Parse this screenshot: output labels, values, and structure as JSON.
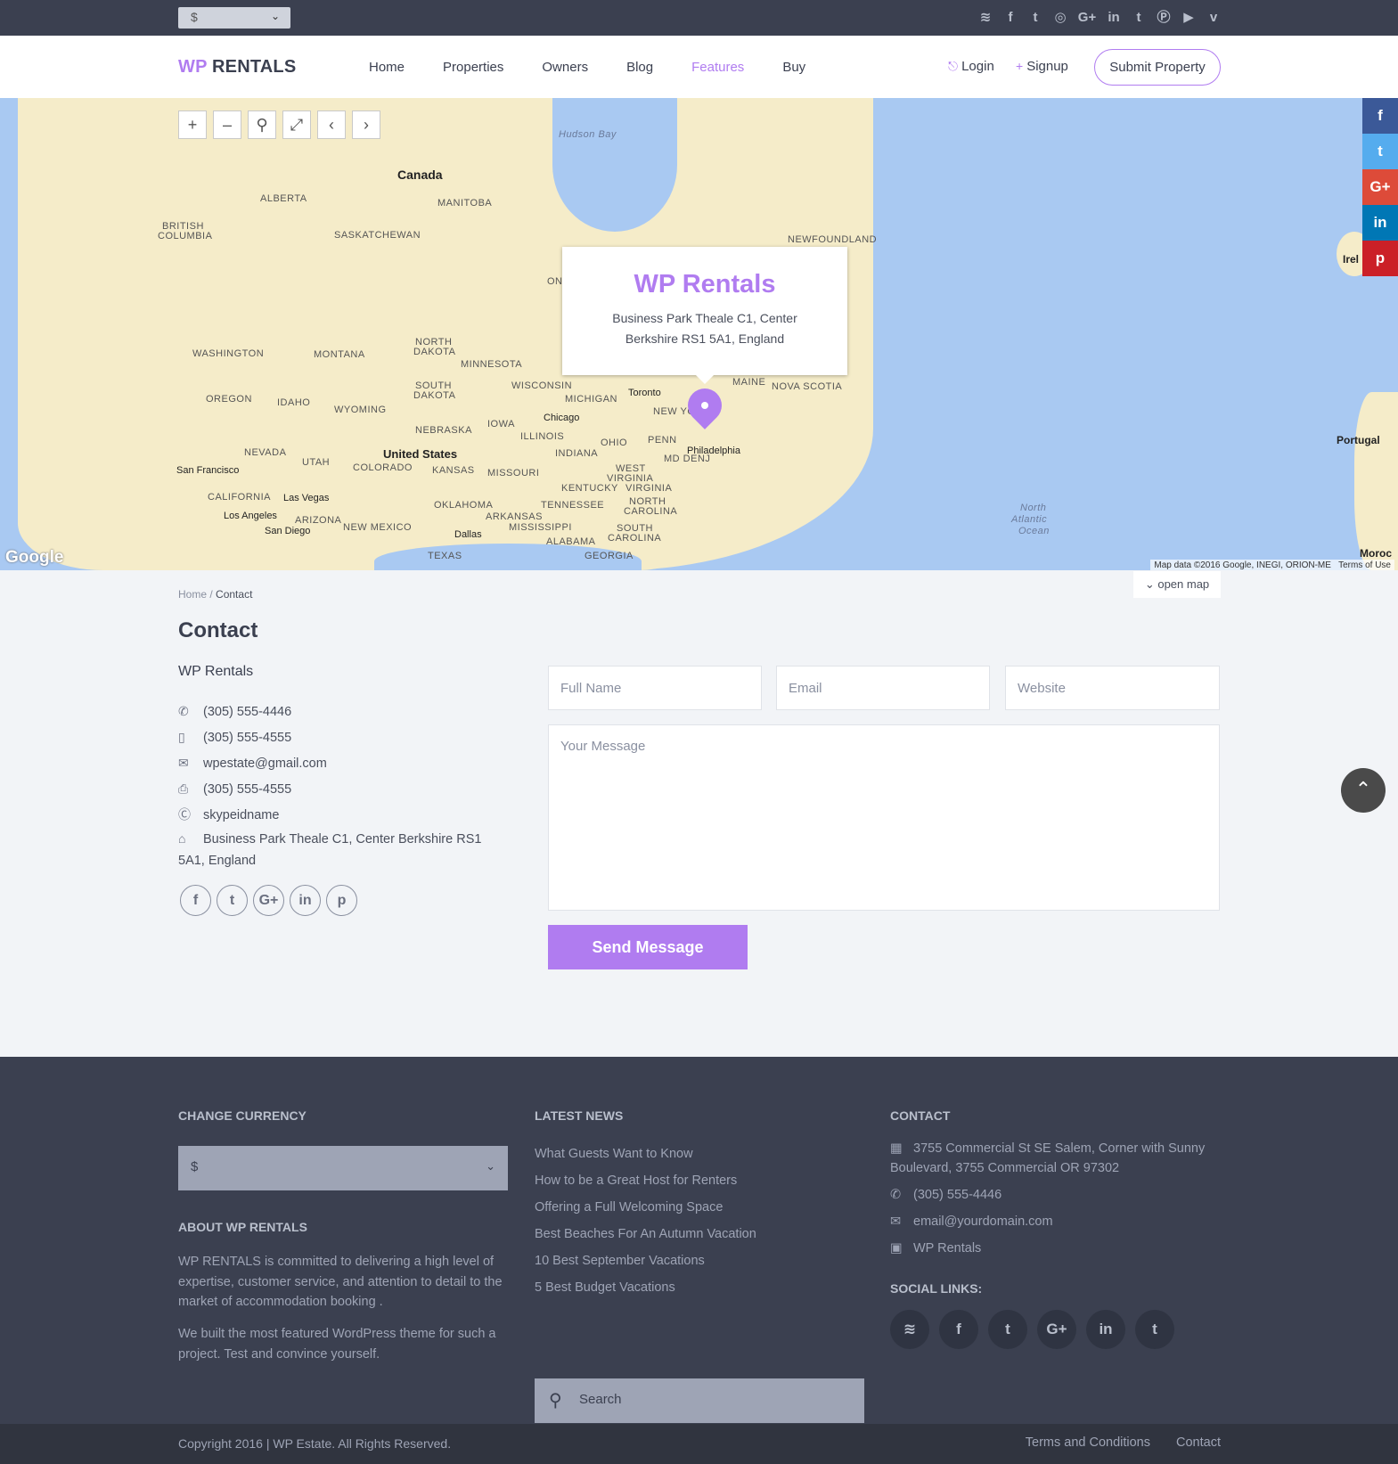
{
  "topbar": {
    "currency": "$",
    "social_icons": [
      "rss-icon",
      "facebook-icon",
      "twitter-icon",
      "dribbble-icon",
      "google-plus-icon",
      "linkedin-icon",
      "tumblr-icon",
      "pinterest-icon",
      "youtube-icon",
      "vimeo-icon"
    ]
  },
  "header": {
    "logo_wp": "WP",
    "logo_rest": "RENTALS",
    "nav": [
      "Home",
      "Properties",
      "Owners",
      "Blog",
      "Features",
      "Buy"
    ],
    "nav_active": "Features",
    "login": "Login",
    "signup": "Signup",
    "submit": "Submit Property"
  },
  "map": {
    "labels": {
      "hudson_bay": "Hudson Bay",
      "canada": "Canada",
      "alberta": "ALBERTA",
      "manitoba": "MANITOBA",
      "bc1": "BRITISH",
      "bc2": "COLUMBIA",
      "saskatchewan": "SASKATCHEWAN",
      "newfoundland": "NEWFOUNDLAND",
      "on": "ON",
      "washington": "WASHINGTON",
      "montana": "MONTANA",
      "north_dakota1": "NORTH",
      "north_dakota2": "DAKOTA",
      "minnesota": "MINNESOTA",
      "south_dakota1": "SOUTH",
      "south_dakota2": "DAKOTA",
      "wisconsin": "WISCONSIN",
      "michigan": "MICHIGAN",
      "toronto": "Toronto",
      "maine": "MAINE",
      "nova_scotia": "NOVA SCOTIA",
      "oregon": "OREGON",
      "idaho": "IDAHO",
      "wyoming": "WYOMING",
      "chicago": "Chicago",
      "iowa": "IOWA",
      "nebraska": "NEBRASKA",
      "new_york": "NEW YO",
      "nevada": "NEVADA",
      "united_states": "United States",
      "illinois": "ILLINOIS",
      "indiana": "INDIANA",
      "ohio": "OHIO",
      "penn": "PENN",
      "philadelphia": "Philadelphia",
      "utah": "UTAH",
      "colorado": "COLORADO",
      "kansas": "KANSAS",
      "missouri": "MISSOURI",
      "west_virginia1": "WEST",
      "west_virginia2": "VIRGINIA",
      "virginia": "VIRGINIA",
      "kentucky": "KENTUCKY",
      "md_denj": "MD DENJ",
      "san_francisco": "San Francisco",
      "california": "CALIFORNIA",
      "las_vegas": "Las Vegas",
      "los_angeles": "Los Angeles",
      "arizona": "ARIZONA",
      "san_diego": "San Diego",
      "new_mexico": "NEW MEXICO",
      "oklahoma": "OKLAHOMA",
      "arkansas": "ARKANSAS",
      "tennessee": "TENNESSEE",
      "north_carolina1": "NORTH",
      "north_carolina2": "CAROLINA",
      "dallas": "Dallas",
      "mississippi": "MISSISSIPPI",
      "south_carolina1": "SOUTH",
      "south_carolina2": "CAROLINA",
      "alabama": "ALABAMA",
      "georgia": "GEORGIA",
      "texas": "TEXAS",
      "ireland": "Irel",
      "portugal": "Portugal",
      "morocco": "Moroc",
      "ocean1": "North",
      "ocean2": "Atlantic",
      "ocean3": "Ocean"
    },
    "info_title": "WP Rentals",
    "info_address": "Business Park Theale C1, Center Berkshire RS1 5A1, England",
    "google": "Google",
    "map_data": "Map data ©2016 Google, INEGI, ORION-ME",
    "terms": "Terms of Use"
  },
  "side_share": [
    "f",
    "t",
    "G+",
    "in",
    "p"
  ],
  "contact": {
    "open_map": "open map",
    "breadcrumb_home": "Home",
    "breadcrumb_sep": "/",
    "breadcrumb_current": "Contact",
    "title": "Contact",
    "company": "WP Rentals",
    "phone": "(305) 555-4446",
    "mobile": "(305) 555-4555",
    "email": "wpestate@gmail.com",
    "fax": "(305) 555-4555",
    "skype": "skypeidname",
    "address": "Business Park Theale C1, Center Berkshire RS1 5A1, England",
    "social": [
      "f",
      "t",
      "G+",
      "in",
      "p"
    ],
    "form": {
      "name_placeholder": "Full Name",
      "email_placeholder": "Email",
      "website_placeholder": "Website",
      "message_placeholder": "Your Message",
      "send": "Send Message"
    }
  },
  "footer": {
    "currency_heading": "CHANGE CURRENCY",
    "currency": "$",
    "about_heading": "ABOUT WP RENTALS",
    "about_p1": "WP RENTALS is committed to delivering a high level of expertise, customer service, and attention to detail to the market of accommodation booking .",
    "about_p2": "We built the most featured WordPress theme for such a project. Test and convince yourself.",
    "news_heading": "LATEST NEWS",
    "news": [
      "What Guests Want to Know",
      "How to be a Great Host for Renters",
      "Offering a Full Welcoming Space",
      "Best Beaches For An Autumn Vacation",
      "10 Best September Vacations",
      "5 Best Budget Vacations"
    ],
    "search_placeholder": "Search",
    "contact_heading": "CONTACT",
    "address": "3755 Commercial St SE Salem, Corner with Sunny Boulevard, 3755 Commercial OR 97302",
    "phone": "(305) 555-4446",
    "email": "email@yourdomain.com",
    "site": "WP Rentals",
    "social_heading": "SOCIAL LINKS:",
    "social": [
      "rss",
      "f",
      "t",
      "G+",
      "in",
      "t"
    ]
  },
  "bottom": {
    "copyright": "Copyright 2016 | WP Estate. All Rights Reserved.",
    "terms": "Terms and Conditions",
    "contact": "Contact"
  },
  "colors": {
    "accent": "#b07cf0",
    "dark": "#3b4050",
    "footer_bottom": "#30343f"
  }
}
